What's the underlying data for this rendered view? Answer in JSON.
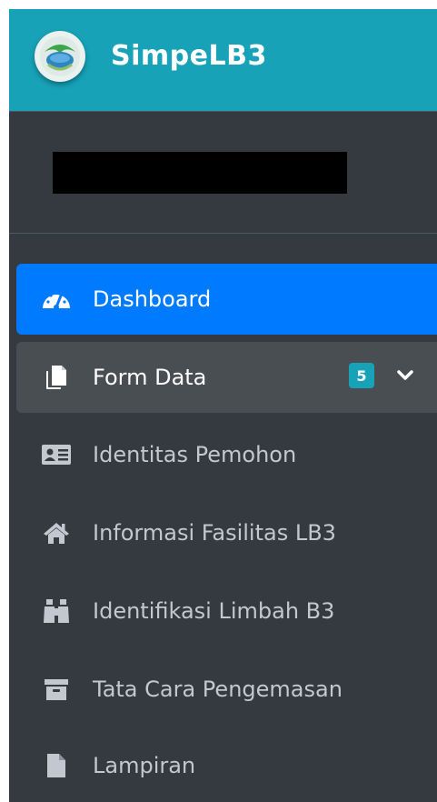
{
  "brand": {
    "name": "SimpeLB3",
    "logo_icon": "globe-leaf-logo"
  },
  "user": {
    "name": ""
  },
  "nav": {
    "dashboard": {
      "label": "Dashboard",
      "icon": "tachometer-icon"
    },
    "form_data": {
      "label": "Form Data",
      "icon": "copy-icon",
      "badge": "5"
    },
    "sub_items": [
      {
        "label": "Identitas Pemohon",
        "icon": "id-card-icon"
      },
      {
        "label": "Informasi Fasilitas LB3",
        "icon": "home-icon"
      },
      {
        "label": "Identifikasi Limbah B3",
        "icon": "binoculars-icon"
      },
      {
        "label": "Tata Cara Pengemasan",
        "icon": "archive-icon"
      },
      {
        "label": "Lampiran",
        "icon": "file-icon"
      }
    ]
  },
  "colors": {
    "brand_bar": "#17a2b8",
    "sidebar_bg": "#343a40",
    "active": "#007bff",
    "badge": "#17a2b8"
  }
}
